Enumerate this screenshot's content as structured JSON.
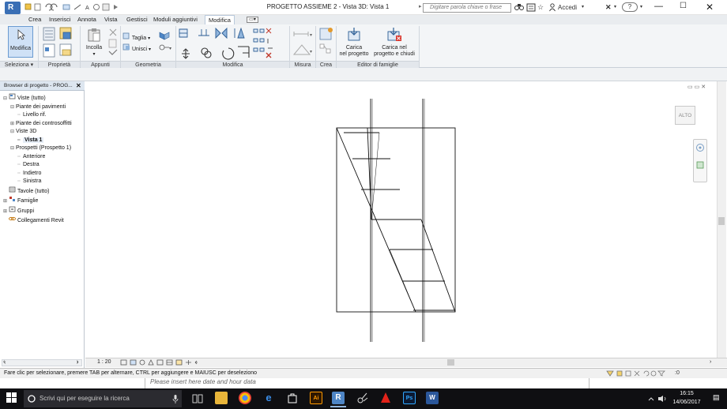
{
  "app": {
    "logo_letter": "R",
    "title": "PROGETTO ASSIEME 2 - Vista 3D: Vista 1",
    "search_placeholder": "Digitare parola chiave o frase",
    "sign_in": "Accedi",
    "help": "?"
  },
  "tabs": [
    {
      "label": "Crea",
      "active": false
    },
    {
      "label": "Inserisci",
      "active": false
    },
    {
      "label": "Annota",
      "active": false
    },
    {
      "label": "Vista",
      "active": false
    },
    {
      "label": "Gestisci",
      "active": false
    },
    {
      "label": "Moduli aggiuntivi",
      "active": false
    },
    {
      "label": "Modifica",
      "active": true
    }
  ],
  "ribbon": {
    "modify_button": "Modifica",
    "paste_button": "Incolla",
    "cut": "Taglia",
    "join": "Unisci",
    "load_project": [
      "Carica",
      "nel progetto"
    ],
    "load_project_close": [
      "Carica nel",
      "progetto e chiudi"
    ],
    "panels": {
      "select": "Seleziona ▾",
      "properties": "Proprietà",
      "clipboard": "Appunti",
      "geometry": "Geometria",
      "modify": "Modifica",
      "measure": "Misura",
      "create": "Crea",
      "family_editor": "Editor di famiglie"
    }
  },
  "browser": {
    "title": "Browser di progetto - PROG...",
    "close": "✕",
    "nodes": [
      {
        "label": "Viste (tutto)",
        "level": 0,
        "toggle": "⊟",
        "icon": "views"
      },
      {
        "label": "Piante dei pavimenti",
        "level": 1,
        "toggle": "⊟"
      },
      {
        "label": "Livello rif.",
        "level": 2,
        "toggle": ""
      },
      {
        "label": "Piante dei controsoffitti",
        "level": 1,
        "toggle": "⊞"
      },
      {
        "label": "Viste 3D",
        "level": 1,
        "toggle": "⊟"
      },
      {
        "label": "Vista 1",
        "level": 2,
        "toggle": "",
        "selected": true
      },
      {
        "label": "Prospetti (Prospetto 1)",
        "level": 1,
        "toggle": "⊟"
      },
      {
        "label": "Anteriore",
        "level": 2,
        "toggle": ""
      },
      {
        "label": "Destra",
        "level": 2,
        "toggle": ""
      },
      {
        "label": "Indietro",
        "level": 2,
        "toggle": ""
      },
      {
        "label": "Sinistra",
        "level": 2,
        "toggle": ""
      },
      {
        "label": "Tavole (tutto)",
        "level": 0,
        "toggle": "",
        "icon": "sheets"
      },
      {
        "label": "Famiglie",
        "level": 0,
        "toggle": "⊞",
        "icon": "families"
      },
      {
        "label": "Gruppi",
        "level": 0,
        "toggle": "⊞",
        "icon": "groups"
      },
      {
        "label": "Collegamenti Revit",
        "level": 0,
        "toggle": "",
        "icon": "links"
      }
    ]
  },
  "canvas": {
    "viewcube_label": "ALTO"
  },
  "viewbar": {
    "scale": "1 : 20"
  },
  "status": {
    "message": "Fare clic per selezionare, premere TAB per alternare, CTRL per aggiungere e MAIUSC per deseleziono",
    "filter_count": ":0"
  },
  "background_doc": {
    "placeholder": "Please insert here date and hour data"
  },
  "taskbar": {
    "search_placeholder": "Scrivi qui per eseguire la ricerca",
    "time": "16:15",
    "date": "14/06/2017"
  },
  "colors": {
    "accent": "#3a6fb5",
    "ribbon_bg": "#f3f5f7",
    "taskbar_bg": "#0f0f12"
  }
}
